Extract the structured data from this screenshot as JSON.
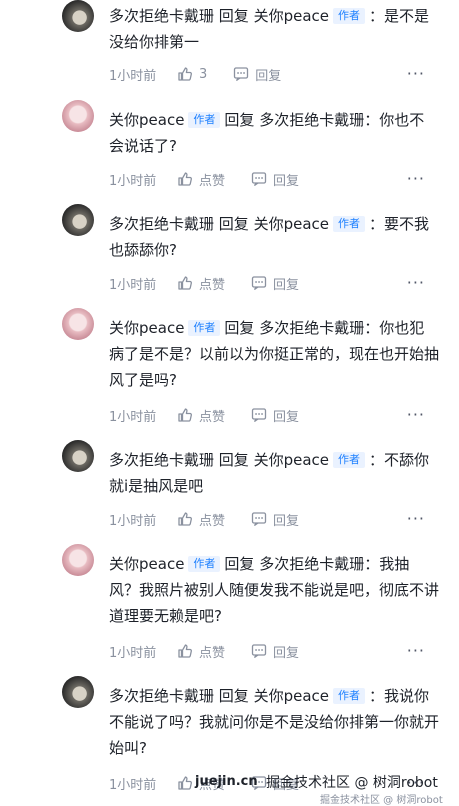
{
  "comments": [
    {
      "avatar": "dark",
      "author": "多次拒绝卡戴珊",
      "tag": "",
      "reply": "回复",
      "target": "关你peace",
      "target_tag": "作者",
      "text_line1": "：是不",
      "text_rest": "是没给你排第一",
      "time": "1小时前",
      "like": "3",
      "reply_btn": "回复"
    },
    {
      "avatar": "pink",
      "author": "关你peace",
      "tag": "作者",
      "reply": "回复",
      "target": "多次拒绝卡戴珊",
      "target_tag": "",
      "text_line1": "：你也",
      "text_rest": "不会说话了?",
      "time": "1小时前",
      "like": "点赞",
      "reply_btn": "回复"
    },
    {
      "avatar": "dark",
      "author": "多次拒绝卡戴珊",
      "tag": "",
      "reply": "回复",
      "target": "关你peace",
      "target_tag": "作者",
      "text_line1": "：要不",
      "text_rest": "我也舔舔你?",
      "time": "1小时前",
      "like": "点赞",
      "reply_btn": "回复"
    },
    {
      "avatar": "pink",
      "author": "关你peace",
      "tag": "作者",
      "reply": "回复",
      "target": "多次拒绝卡戴珊",
      "target_tag": "",
      "text_line1": "：你也",
      "text_rest": "犯病了是不是？以前以为你挺正常的，现在也开始抽风了是吗?",
      "time": "1小时前",
      "like": "点赞",
      "reply_btn": "回复"
    },
    {
      "avatar": "dark",
      "author": "多次拒绝卡戴珊",
      "tag": "",
      "reply": "回复",
      "target": "关你peace",
      "target_tag": "作者",
      "text_line1": "：不舔",
      "text_rest": "你就i是抽风是吧",
      "time": "1小时前",
      "like": "点赞",
      "reply_btn": "回复"
    },
    {
      "avatar": "pink",
      "author": "关你peace",
      "tag": "作者",
      "reply": "回复",
      "target": "多次拒绝卡戴珊",
      "target_tag": "",
      "text_line1": "：我抽",
      "text_rest": "风？我照片被别人随便发我不能说是吧，彻底不讲道理要无赖是吧?",
      "time": "1小时前",
      "like": "点赞",
      "reply_btn": "回复"
    },
    {
      "avatar": "dark",
      "author": "多次拒绝卡戴珊",
      "tag": "",
      "reply": "回复",
      "target": "关你peace",
      "target_tag": "作者",
      "text_line1": "：我说",
      "text_rest": "你不能说了吗？我就问你是不是没给你排第一你就开始叫?",
      "time": "1小时前",
      "like": "点赞",
      "reply_btn": "回复"
    }
  ],
  "more_glyph": "···",
  "footer": {
    "site": "juejin.cn",
    "watermark": "掘金技术社区 @ 树洞robot",
    "watermark_small": "掘金技术社区 @ 树洞robot"
  }
}
